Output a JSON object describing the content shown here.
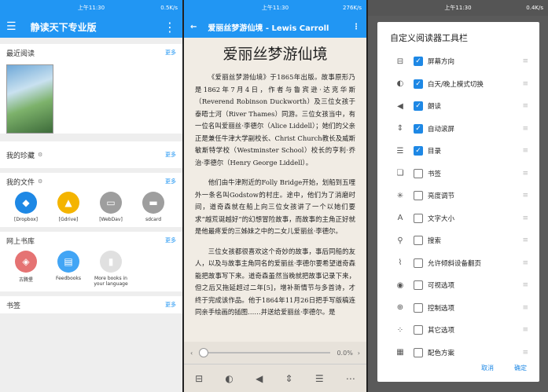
{
  "status": {
    "time": "上午11:30",
    "net1": "0.5K/s",
    "net2": "276K/s",
    "net3": "0.4K/s"
  },
  "home": {
    "title": "静读天下专业版",
    "menu_icon": "hamburger-icon",
    "more": "更多",
    "recent": "最近阅读",
    "favs": "我的珍藏",
    "files": "我的文件",
    "online": "网上书库",
    "bookmarks": "书签",
    "file_items": [
      {
        "label": "[Dropbox]",
        "color": "#1e88e5",
        "icon": "◆"
      },
      {
        "label": "[Gdrive]",
        "color": "#f4b400",
        "icon": "▲"
      },
      {
        "label": "[WebDav]",
        "color": "#9e9e9e",
        "icon": "▭"
      },
      {
        "label": "sdcard",
        "color": "#9e9e9e",
        "icon": "▬"
      }
    ],
    "online_items": [
      {
        "label": "古腾堡",
        "color": "#e57373",
        "icon": "◈"
      },
      {
        "label": "Feedbooks",
        "color": "#42a5f5",
        "icon": "▤"
      },
      {
        "label": "More books in your language",
        "color": "#e0e0e0",
        "icon": "▮"
      }
    ]
  },
  "reader": {
    "title": "爱丽丝梦游仙境 - Lewis Carroll",
    "book_title": "爱丽丝梦游仙境",
    "p1": "《爱丽丝梦游仙境》于1865年出版。故事原形乃是1862年7月4日，作者与鲁宾逊·达克华斯（Reverend Robinson Duckworth）及三位女孩于泰晤士河（River Thames）同游。三位女孩当中，有一位名叫爱丽丝·李德尔（Alice Liddell）；她们的父亲正是兼任牛津大学副校长、Christ Church教长及威斯敏斯特学校（Westminster School）校长的亨利·乔治·李德尔（Henry George Liddell）。",
    "p2": "他们由牛津附近的Folly Bridge开始，划船到五哩外一条名叫Godstow的村庄。途中，他们为了消磨时间，道奇森就在船上向三位女孩讲了一个以她们要求“越荒诞越好”的幻想冒险故事，而故事的主角正好就是他最疼爱的三姊妹之中的二女儿爱丽丝·李德尔。",
    "p3": "三位女孩都很喜欢这个奇妙的故事，事后同船的友人，以及与故事主角同名的爱丽丝·李德尔要希望道奇森能把故事写下来。道奇森虽然当晚就把故事记录下来，但之后又拖延超过二年[5]，增补新情节与多首诗，才终于完成该作品。他于1864年11月26日把手写版稿连同亲手绘画的插图……并送给爱丽丝·李德尔。是",
    "progress": "0.0%",
    "progress_value": 0
  },
  "settings": {
    "title": "自定义阅读器工具栏",
    "cancel": "取消",
    "ok": "确定",
    "items": [
      {
        "label": "屏幕方向",
        "checked": true,
        "icon": "⊟"
      },
      {
        "label": "白天/晚上模式切换",
        "checked": true,
        "icon": "◐"
      },
      {
        "label": "朗读",
        "checked": true,
        "icon": "◀"
      },
      {
        "label": "自动滚屏",
        "checked": true,
        "icon": "⇕"
      },
      {
        "label": "目录",
        "checked": true,
        "icon": "☰"
      },
      {
        "label": "书签",
        "checked": false,
        "icon": "❏"
      },
      {
        "label": "亮度调节",
        "checked": false,
        "icon": "✳"
      },
      {
        "label": "文字大小",
        "checked": false,
        "icon": "A"
      },
      {
        "label": "搜索",
        "checked": false,
        "icon": "⚲"
      },
      {
        "label": "允许倾斜设备翻页",
        "checked": false,
        "icon": "⌇"
      },
      {
        "label": "可视选项",
        "checked": false,
        "icon": "◉"
      },
      {
        "label": "控制选项",
        "checked": false,
        "icon": "⊕"
      },
      {
        "label": "其它选项",
        "checked": false,
        "icon": "⁘"
      },
      {
        "label": "配色方案",
        "checked": false,
        "icon": "▦"
      }
    ]
  }
}
